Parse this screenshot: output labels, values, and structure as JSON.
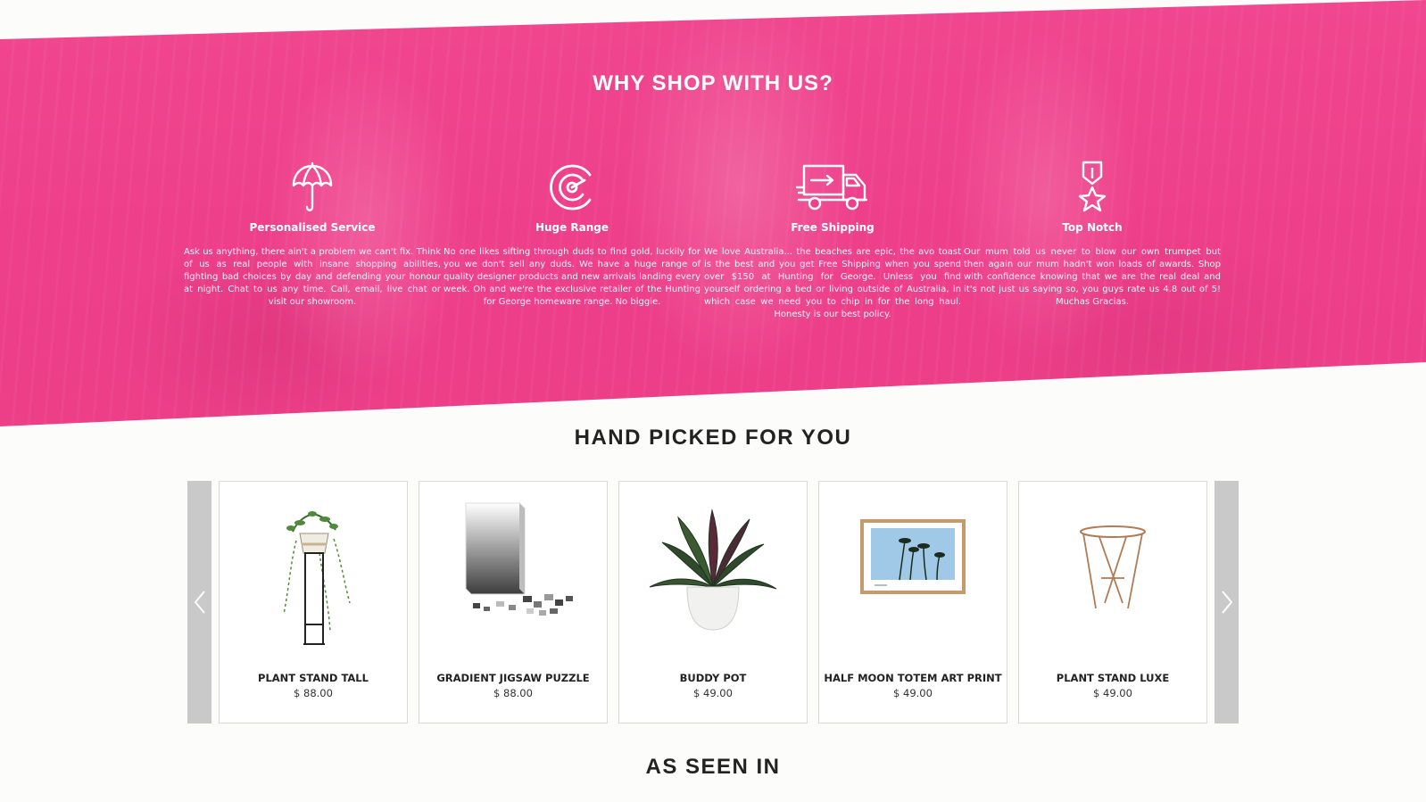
{
  "hero": {
    "title": "WHY SHOP WITH US?",
    "features": [
      {
        "icon": "umbrella-icon",
        "title": "Personalised Service",
        "text": "Ask us anything, there ain't a problem we can't fix. Think of us as real people with insane shopping abilities, fighting bad choices by day and defending your honour at night. Chat to us any time. Call, email, live chat or visit our showroom."
      },
      {
        "icon": "target-icon",
        "title": "Huge Range",
        "text": "No one likes sifting through duds to find gold, luckily for you we don't sell any duds. We have a huge range of quality designer products and new arrivals landing every week. Oh and we're the exclusive retailer of the Hunting for George homeware range. No biggie."
      },
      {
        "icon": "delivery-truck-icon",
        "title": "Free Shipping",
        "text": "We love Australia... the beaches are epic, the avo toast is the best and you get Free Shipping when you spend over $150 at Hunting for George. Unless you find yourself ordering a bed or living outside of Australia, in which case we need you to chip in for the long haul. Honesty is our best policy."
      },
      {
        "icon": "medal-icon",
        "title": "Top Notch",
        "text": "Our mum told us never to blow our own trumpet but then again our mum hadn't won loads of awards. Shop with confidence knowing that we are the real deal and it's not just us saying so, you guys rate us 4.8 out of 5! Muchas Gracias."
      }
    ]
  },
  "hand_picked": {
    "title": "HAND PICKED FOR YOU",
    "prev_icon": "chevron-left-icon",
    "next_icon": "chevron-right-icon",
    "products": [
      {
        "name": "PLANT STAND TALL",
        "price": "$ 88.00"
      },
      {
        "name": "GRADIENT JIGSAW PUZZLE",
        "price": "$ 88.00"
      },
      {
        "name": "BUDDY POT",
        "price": "$ 49.00"
      },
      {
        "name": "HALF MOON TOTEM ART PRINT",
        "price": "$ 49.00"
      },
      {
        "name": "PLANT STAND LUXE",
        "price": "$ 49.00"
      }
    ]
  },
  "as_seen_in": {
    "title": "AS SEEN IN"
  },
  "colors": {
    "hero_pink": "#ee3f8a",
    "arrow_grey": "#c9c9c9",
    "card_border": "#d9d9d9"
  }
}
